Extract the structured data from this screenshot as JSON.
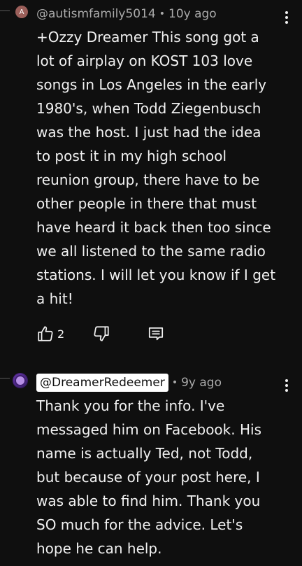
{
  "comment1": {
    "avatar_letter": "A",
    "handle": "@autismfamily5014",
    "separator": "•",
    "time": "10y ago",
    "text_lines": [
      "+Ozzy Dreamer  This song got a",
      "lot of airplay on KOST 103 love",
      "songs in Los Angeles in the early",
      "1980's, when Todd Ziegenbusch",
      "was the host. I just had the idea",
      "to post it in my high school",
      "reunion group, there have to be",
      "other people in there that must",
      "have heard it back then too since",
      "we all listened to the same radio",
      "stations. I will let you know if I get",
      "a hit!"
    ],
    "like_count": "2",
    "icons": [
      "thumbs-up-icon",
      "thumbs-down-icon",
      "comment-icon",
      "more-vert-icon"
    ]
  },
  "comment2": {
    "handle": "@DreamerRedeemer",
    "separator": "•",
    "time": "9y ago",
    "text_lines": [
      "Thank you for the info.  I've",
      "messaged him on Facebook.  His",
      "name is actually Ted, not Todd,",
      "but because of your post here, I",
      "was able to find him.  Thank you",
      "SO much for the advice.  Let's",
      "hope he can help."
    ],
    "icons": [
      "more-vert-icon"
    ]
  },
  "colors": {
    "background": "#0f0f0f",
    "text": "#f1f1f1",
    "meta_text": "#aaaaaa",
    "avatar_letter_bg": "#9b5f5a",
    "handle_chip_bg": "#ffffff"
  }
}
